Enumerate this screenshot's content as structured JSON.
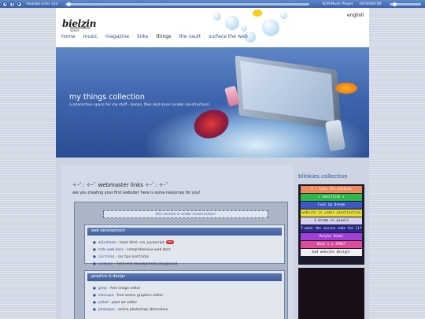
{
  "player": {
    "track": "Youtube Error 150",
    "app_name": "SCM Music Player",
    "time": "00:00/00:00",
    "progress": 0.0,
    "volume": 0.2
  },
  "header": {
    "logo_text": "bielzin",
    "logo_tag": "space",
    "language": "english",
    "nav": [
      {
        "label": "home"
      },
      {
        "label": "music"
      },
      {
        "label": "magazine"
      },
      {
        "label": "links"
      },
      {
        "label": "things",
        "active": true
      },
      {
        "label": "the vault"
      },
      {
        "label": "surface the web"
      }
    ]
  },
  "hero": {
    "title": "my things collection",
    "subtitle": "a interactive space for my stuff - books, files and more (under construction)"
  },
  "main": {
    "section_title": "✧･ﾟ: ✧･ﾟ webmaster links ✧･ﾟ: ✧･ﾟ",
    "section_subtitle": "are you creating your first website? here is some resources for you!",
    "notice": "this section is under construction!",
    "boxes": [
      {
        "title": "web development",
        "items": [
          {
            "name": "w3schools",
            "desc": " - learn html, css, javascript",
            "badge": "new"
          },
          {
            "name": "mdn web docs",
            "desc": " - comprehensive web docs"
          },
          {
            "name": "css tricks",
            "desc": " - css tips and tricks"
          },
          {
            "name": "codepen",
            "desc": " - front-end development playground"
          }
        ]
      },
      {
        "title": "graphics & design",
        "items": [
          {
            "name": "gimp",
            "desc": " - free image editor"
          },
          {
            "name": "inkscape",
            "desc": " - free vector graphics editor"
          },
          {
            "name": "piskel",
            "desc": " - pixel art editor"
          },
          {
            "name": "photopea",
            "desc": " - online photoshop alternative"
          }
        ]
      }
    ]
  },
  "sidebar": {
    "title": "blinkies collection",
    "blinkies": [
      {
        "text": "I ♡ love the pinkies",
        "bg": "#f08a5a",
        "fg": "#ffffff"
      },
      {
        "text": "✦ neocities ✦",
        "bg": "#2fb84a",
        "fg": "#ffffff"
      },
      {
        "text": "Fuel by Dream",
        "bg": "#3a58c8",
        "fg": "#ffffff"
      },
      {
        "text": "website is under construction",
        "bg": "#e8e030",
        "fg": "#333333"
      },
      {
        "text": "I dream in pixels",
        "bg": "#d8d0f0",
        "fg": "#222222"
      },
      {
        "text": "I want the source code for life",
        "bg": "#2a2a88",
        "fg": "#ffffff"
      },
      {
        "text": "Purple Power",
        "bg": "#a040d8",
        "fg": "#ffffff"
      },
      {
        "text": "What's a JPEG?",
        "bg": "#e04a9a",
        "fg": "#ffffff"
      },
      {
        "text": "bad website design!",
        "bg": "#f0f0f0",
        "fg": "#222222"
      }
    ]
  }
}
